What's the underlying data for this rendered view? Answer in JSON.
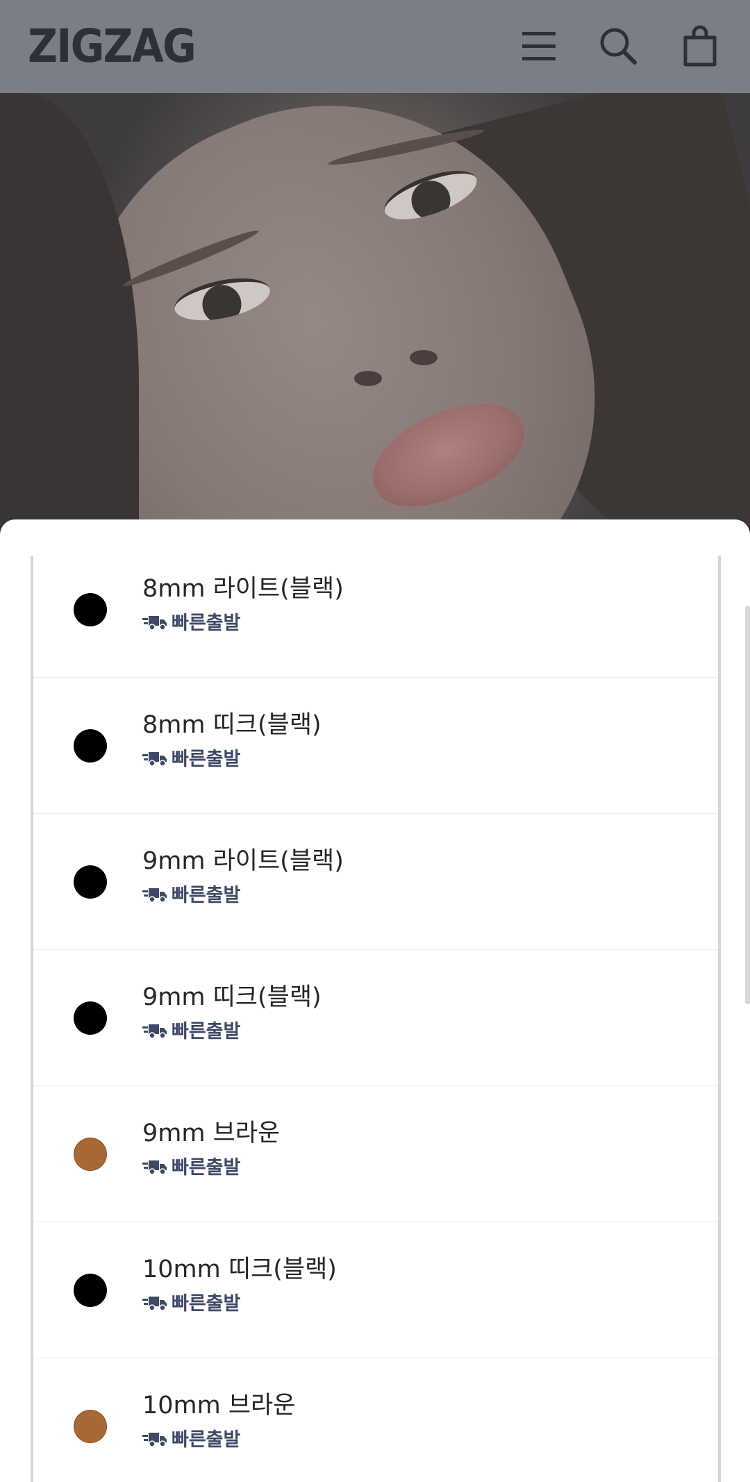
{
  "header": {
    "logo": "ZIGZAG",
    "icons": {
      "menu": "menu-icon",
      "search": "search-icon",
      "cart": "shopping-bag-icon"
    }
  },
  "colors": {
    "shipping_badge": "#3d4a66",
    "swatch_black": "#000000",
    "swatch_brown": "#a86835"
  },
  "options": [
    {
      "label": "8mm 라이트(블랙)",
      "badge": "빠른출발",
      "swatch": "#000000"
    },
    {
      "label": "8mm 띠크(블랙)",
      "badge": "빠른출발",
      "swatch": "#000000"
    },
    {
      "label": "9mm 라이트(블랙)",
      "badge": "빠른출발",
      "swatch": "#000000"
    },
    {
      "label": "9mm 띠크(블랙)",
      "badge": "빠른출발",
      "swatch": "#000000"
    },
    {
      "label": "9mm 브라운",
      "badge": "빠른출발",
      "swatch": "#a86835"
    },
    {
      "label": "10mm 띠크(블랙)",
      "badge": "빠른출발",
      "swatch": "#000000"
    },
    {
      "label": "10mm 브라운",
      "badge": "빠른출발",
      "swatch": "#a86835"
    }
  ]
}
